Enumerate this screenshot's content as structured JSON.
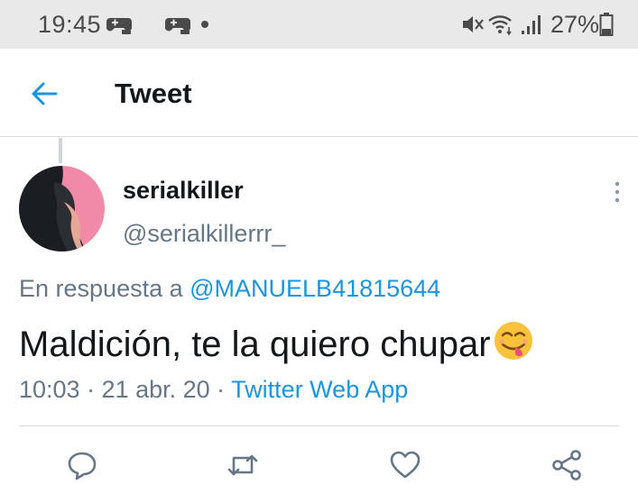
{
  "status_bar": {
    "time": "19:45",
    "battery": "27%",
    "icons": [
      "game-controller-icon",
      "game-controller-icon",
      "notification-dot-icon",
      "vibrate-icon",
      "wifi-icon",
      "signal-icon",
      "battery-icon"
    ]
  },
  "header": {
    "title": "Tweet",
    "back_icon": "arrow-left-icon"
  },
  "tweet": {
    "display_name": "serialkiller",
    "handle": "@serialkillerrr_",
    "reply_prefix": "En respuesta a ",
    "reply_mention": "@MANUELB41815644",
    "text": "Maldición, te la quiero chupar",
    "emoji": "face-savoring-food-emoji",
    "timestamp": "10:03 · 21 abr. 20 · ",
    "source": "Twitter Web App"
  },
  "actions": {
    "icons": [
      "reply-icon",
      "retweet-icon",
      "like-icon",
      "share-icon"
    ]
  },
  "colors": {
    "accent": "#1b95e0",
    "secondary_text": "#657786",
    "status_bar_bg": "#e9e9e9",
    "avatar_bg": "#f08aa6"
  }
}
